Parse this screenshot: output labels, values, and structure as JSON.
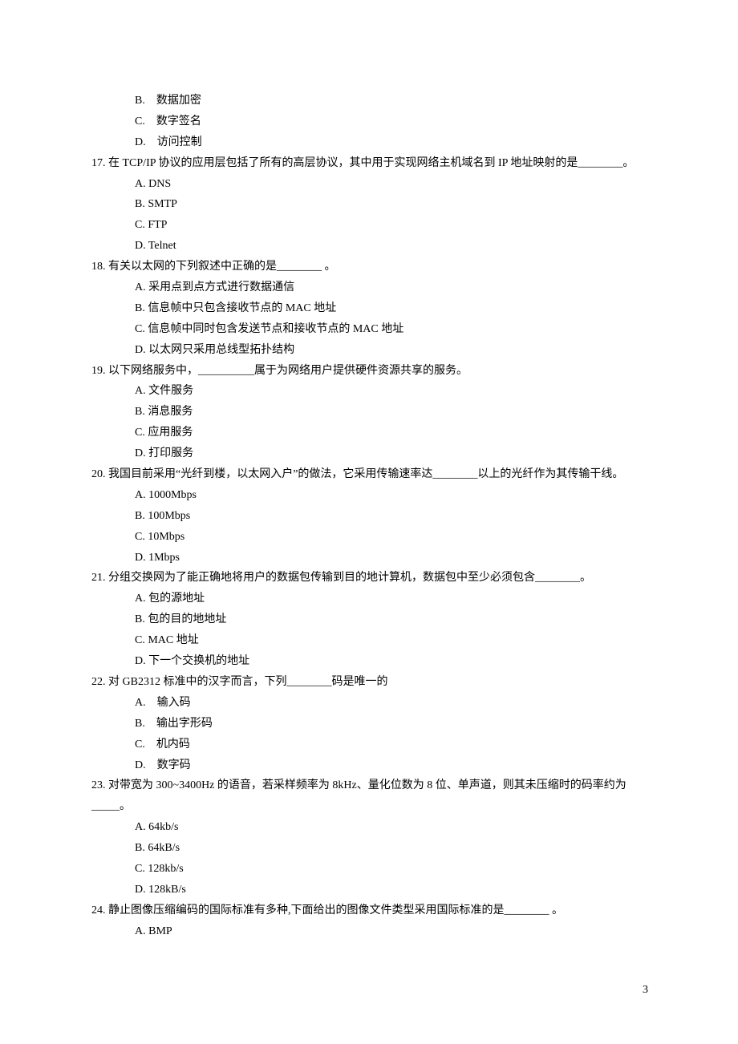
{
  "q16": {
    "opts": {
      "B": "B.　数据加密",
      "C": "C.　数字签名",
      "D": "D.　访问控制"
    }
  },
  "q17": {
    "stem": "17. 在 TCP/IP 协议的应用层包括了所有的高层协议，其中用于实现网络主机域名到 IP 地址映射的是________。",
    "opts": {
      "A": "A. DNS",
      "B": "B. SMTP",
      "C": "C. FTP",
      "D": "D. Telnet"
    }
  },
  "q18": {
    "stem": "18. 有关以太网的下列叙述中正确的是________ 。",
    "opts": {
      "A": "A. 采用点到点方式进行数据通信",
      "B": "B. 信息帧中只包含接收节点的 MAC 地址",
      "C": "C. 信息帧中同时包含发送节点和接收节点的 MAC 地址",
      "D": "D. 以太网只采用总线型拓扑结构"
    }
  },
  "q19": {
    "stem": "19. 以下网络服务中，__________属于为网络用户提供硬件资源共享的服务。",
    "opts": {
      "A": "A. 文件服务",
      "B": "B. 消息服务",
      "C": "C. 应用服务",
      "D": "D. 打印服务"
    }
  },
  "q20": {
    "stem": "20. 我国目前采用“光纤到楼，以太网入户”的做法，它采用传输速率达________以上的光纤作为其传输干线。",
    "opts": {
      "A": "A. 1000Mbps",
      "B": "B. 100Mbps",
      "C": "C. 10Mbps",
      "D": "D. 1Mbps"
    }
  },
  "q21": {
    "stem": "21. 分组交换网为了能正确地将用户的数据包传输到目的地计算机，数据包中至少必须包含________。",
    "opts": {
      "A": "A. 包的源地址",
      "B": "B. 包的目的地地址",
      "C": "C. MAC 地址",
      "D": "D. 下一个交换机的地址"
    }
  },
  "q22": {
    "stem": "22. 对 GB2312 标准中的汉字而言，下列________码是唯一的",
    "opts": {
      "A": "A.　输入码",
      "B": "B.　输出字形码",
      "C": "C.　机内码",
      "D": "D.　数字码"
    }
  },
  "q23": {
    "stem": "23. 对带宽为 300~3400Hz 的语音，若采样频率为 8kHz、量化位数为 8 位、单声道，则其未压缩时的码率约为_____。",
    "opts": {
      "A": "A. 64kb/s",
      "B": "B. 64kB/s",
      "C": "C. 128kb/s",
      "D": "D. 128kB/s"
    }
  },
  "q24": {
    "stem": "24. 静止图像压缩编码的国际标准有多种,下面给出的图像文件类型采用国际标准的是________ 。",
    "opts": {
      "A": "A. BMP"
    }
  },
  "pageNumber": "3"
}
